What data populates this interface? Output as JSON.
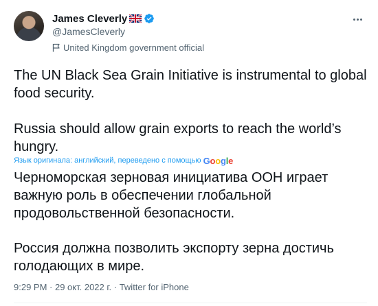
{
  "author": {
    "display_name": "James Cleverly",
    "handle": "@JamesCleverly",
    "label": "United Kingdom government official",
    "flag_icon": "uk-flag-icon",
    "verified_icon": "verified-badge-icon"
  },
  "tweet": {
    "original_paragraphs": [
      "The UN Black Sea Grain Initiative is instrumental to global food security.",
      "Russia should allow grain exports to reach the world’s hungry."
    ],
    "translation_notice": "Язык оригинала: английский, переведено с помощью",
    "translation_provider": [
      "G",
      "o",
      "o",
      "g",
      "l",
      "e"
    ],
    "translated_paragraphs": [
      "Черноморская зерновая инициатива ООН играет важную роль в обеспечении глобальной продовольственной безопасности.",
      "Россия должна позволить экспорту зерна достичь голодающих в мире."
    ],
    "meta": "9:29 PM · 29 окт. 2022 г. · Twitter for iPhone"
  },
  "colors": {
    "text": "#0f1419",
    "secondary": "#536471",
    "link": "#1d9bf0",
    "verified": "#1d9bf0",
    "google_blue": "#4285f4",
    "google_red": "#ea4335",
    "google_yellow": "#fbbc05",
    "google_green": "#34a853"
  }
}
